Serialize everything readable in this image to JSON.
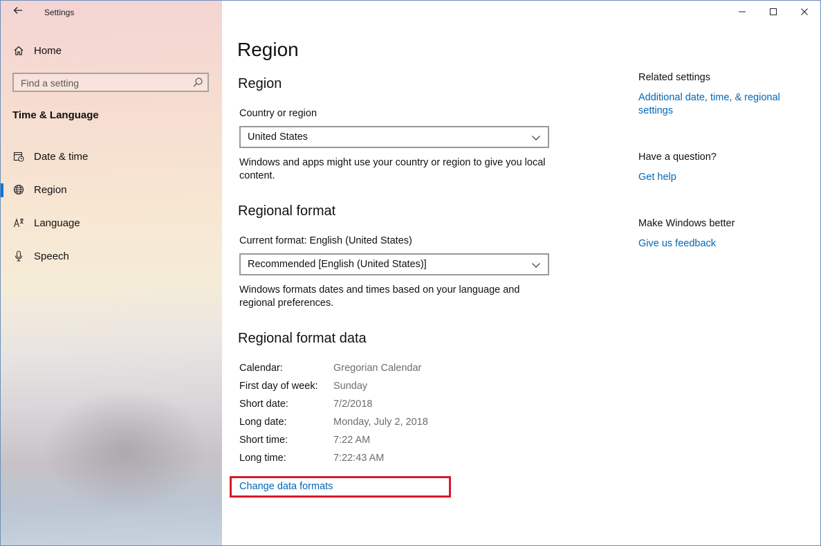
{
  "window": {
    "app_title": "Settings",
    "controls": {
      "minimize": "minimize",
      "maximize": "maximize",
      "close": "close"
    }
  },
  "sidebar": {
    "home_label": "Home",
    "search_placeholder": "Find a setting",
    "section_title": "Time & Language",
    "items": [
      {
        "label": "Date & time",
        "icon": "date-time-icon",
        "selected": false
      },
      {
        "label": "Region",
        "icon": "globe-icon",
        "selected": true
      },
      {
        "label": "Language",
        "icon": "language-icon",
        "selected": false
      },
      {
        "label": "Speech",
        "icon": "microphone-icon",
        "selected": false
      }
    ]
  },
  "main": {
    "page_title": "Region",
    "region": {
      "heading": "Region",
      "country_label": "Country or region",
      "country_value": "United States",
      "description": "Windows and apps might use your country or region to give you local content."
    },
    "regional_format": {
      "heading": "Regional format",
      "current_format_label": "Current format: English (United States)",
      "format_value": "Recommended [English (United States)]",
      "description": "Windows formats dates and times based on your language and regional preferences."
    },
    "format_data": {
      "heading": "Regional format data",
      "rows": [
        {
          "key": "Calendar:",
          "value": "Gregorian Calendar"
        },
        {
          "key": "First day of week:",
          "value": "Sunday"
        },
        {
          "key": "Short date:",
          "value": "7/2/2018"
        },
        {
          "key": "Long date:",
          "value": "Monday, July 2, 2018"
        },
        {
          "key": "Short time:",
          "value": "7:22 AM"
        },
        {
          "key": "Long time:",
          "value": "7:22:43 AM"
        }
      ],
      "change_link": "Change data formats"
    }
  },
  "related": {
    "related_heading": "Related settings",
    "related_link": "Additional date, time, & regional settings",
    "question_heading": "Have a question?",
    "help_link": "Get help",
    "better_heading": "Make Windows better",
    "feedback_link": "Give us feedback"
  },
  "colors": {
    "accent": "#0078d7",
    "link": "#0067b8",
    "highlight_box": "#d61a2a"
  }
}
